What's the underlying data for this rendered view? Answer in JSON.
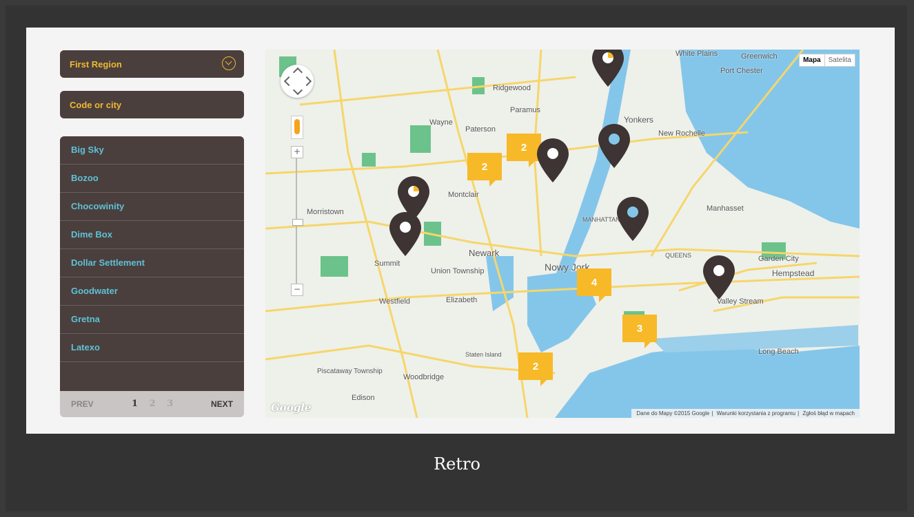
{
  "sidebar": {
    "region_select": "First Region",
    "search_placeholder": "Code or city",
    "items": [
      {
        "label": "Big Sky"
      },
      {
        "label": "Bozoo"
      },
      {
        "label": "Chocowinity"
      },
      {
        "label": "Dime Box"
      },
      {
        "label": "Dollar Settlement"
      },
      {
        "label": "Goodwater"
      },
      {
        "label": "Gretna"
      },
      {
        "label": "Latexo"
      }
    ],
    "pager": {
      "prev": "PREV",
      "next": "NEXT",
      "pages": [
        "1",
        "2",
        "3"
      ],
      "active_page": "1"
    }
  },
  "map": {
    "type_buttons": {
      "map": "Mapa",
      "satellite": "Satelita"
    },
    "clusters": [
      "2",
      "2",
      "4",
      "3",
      "2"
    ],
    "labels": [
      "Paterson",
      "Newark",
      "Nowy Jork",
      "Yonkers",
      "New Rochelle",
      "Union Township",
      "Elizabeth",
      "Hempstead",
      "Wayne",
      "Montclair",
      "Ridgewood",
      "Paramus",
      "Summit",
      "Westfield",
      "Woodbridge",
      "Edison",
      "Long Beach",
      "Valley Stream",
      "Morristown",
      "Garden City",
      "Manhasset",
      "QUEENS",
      "MANHATTAN",
      "Port Chester",
      "Greenwich",
      "White Plains",
      "Piscataway Township",
      "Staten Island"
    ],
    "attribution": [
      "Dane do Mapy ©2015 Google",
      "Warunki korzystania z programu",
      "Zgłoś błąd w mapach"
    ],
    "google_logo": "Google",
    "colors": {
      "water": "#84c6ea",
      "land": "#eef0ea",
      "park": "#6cc28b",
      "road": "#f6d66a",
      "pin": "#3d3433",
      "cluster": "#f7b928"
    }
  },
  "caption": "Retro"
}
